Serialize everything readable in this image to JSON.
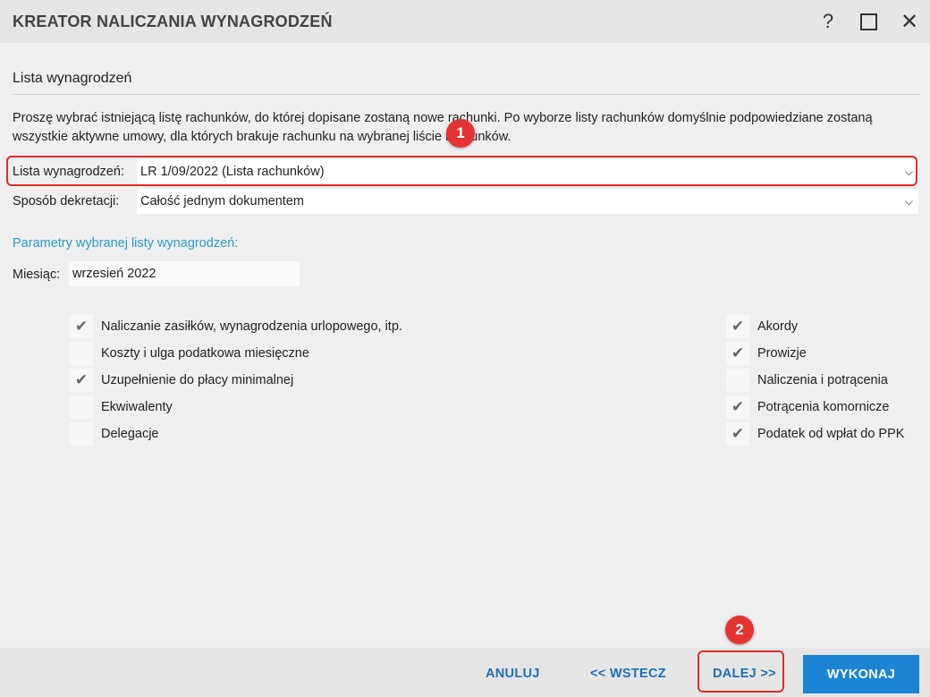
{
  "window": {
    "title": "KREATOR NALICZANIA WYNAGRODZEŃ",
    "help_icon": "question-icon",
    "maximize_icon": "maximize-icon",
    "close_icon": "close-icon"
  },
  "section": {
    "title": "Lista wynagrodzeń",
    "description": "Proszę wybrać istniejącą listę rachunków, do której dopisane zostaną nowe rachunki. Po wyborze listy rachunków domyślnie podpowiedziane zostaną wszystkie aktywne umowy, dla których brakuje rachunku na wybranej liście rachunków."
  },
  "fields": {
    "lista_label": "Lista wynagrodzeń:",
    "lista_value": "LR 1/09/2022 (Lista rachunków)",
    "sposob_label": "Sposób dekretacji:",
    "sposob_value": "Całość jednym dokumentem"
  },
  "params": {
    "title": "Parametry wybranej listy wynagrodzeń:",
    "month_label": "Miesiąc:",
    "month_value": "wrzesień 2022"
  },
  "checkboxes_left": [
    {
      "label": "Naliczanie zasiłków, wynagrodzenia urlopowego, itp.",
      "checked": true
    },
    {
      "label": "Koszty i ulga podatkowa miesięczne",
      "checked": false
    },
    {
      "label": "Uzupełnienie do płacy minimalnej",
      "checked": true
    },
    {
      "label": "Ekwiwalenty",
      "checked": false
    },
    {
      "label": "Delegacje",
      "checked": false
    }
  ],
  "checkboxes_right": [
    {
      "label": "Akordy",
      "checked": true
    },
    {
      "label": "Prowizje",
      "checked": true
    },
    {
      "label": "Naliczenia i potrącenia",
      "checked": false
    },
    {
      "label": "Potrącenia komornicze",
      "checked": true
    },
    {
      "label": "Podatek od wpłat do PPK",
      "checked": true
    }
  ],
  "annotations": {
    "badge1": "1",
    "badge2": "2",
    "accent_color": "#e53333"
  },
  "footer": {
    "cancel": "ANULUJ",
    "back": "<< WSTECZ",
    "next": "DALEJ >>",
    "execute": "WYKONAJ",
    "primary_color": "#1b84d4",
    "link_color": "#1f6fb9"
  }
}
